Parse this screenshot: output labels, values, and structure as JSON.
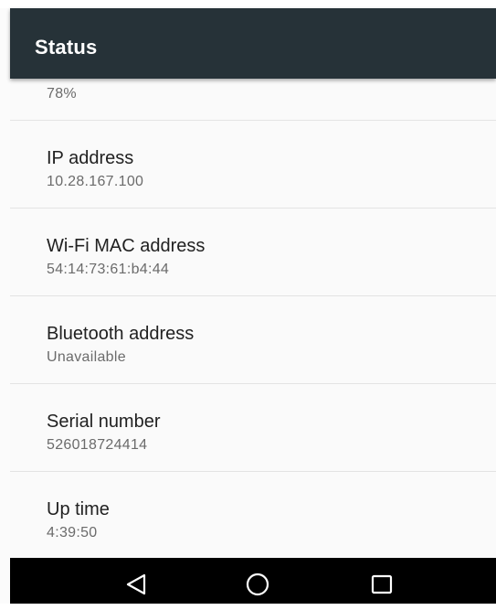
{
  "app_bar": {
    "title": "Status"
  },
  "rows": [
    {
      "title": "",
      "value": "78%"
    },
    {
      "title": "IP address",
      "value": "10.28.167.100"
    },
    {
      "title": "Wi-Fi MAC address",
      "value": "54:14:73:61:b4:44"
    },
    {
      "title": "Bluetooth address",
      "value": "Unavailable"
    },
    {
      "title": "Serial number",
      "value": "526018724414"
    },
    {
      "title": "Up time",
      "value": "4:39:50"
    }
  ],
  "nav": {
    "back_icon": "back-triangle-icon",
    "home_icon": "home-circle-icon",
    "recents_icon": "recents-square-icon"
  },
  "colors": {
    "app_bar": "#263238",
    "nav_bar": "#000000",
    "title_text": "#212121",
    "value_text": "#6b6b6b"
  }
}
